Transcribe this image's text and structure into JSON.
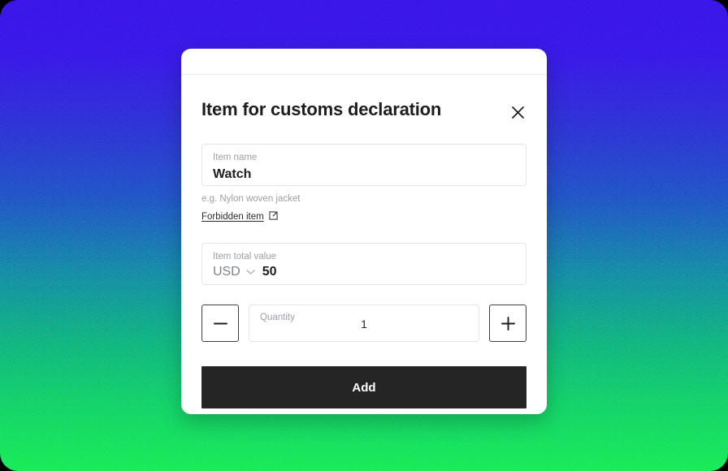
{
  "background": {
    "gradient_top": "#3b16ea",
    "gradient_mid": "#1f60c4",
    "gradient_bottom": "#1aec58"
  },
  "modal": {
    "title": "Item for customs declaration",
    "close_label": "×",
    "close_icon": "close-icon",
    "name_field": {
      "label": "Item name",
      "value": "Watch",
      "placeholder": "Item name"
    },
    "helper_text": "e.g. Nylon woven jacket",
    "forbidden_link": {
      "label": "Forbidden item",
      "icon": "external-link-icon"
    },
    "value_field": {
      "label": "Item total value",
      "currency": "USD",
      "currency_chevron_icon": "chevron-down-icon",
      "amount": "50"
    },
    "quantity": {
      "label": "Quantity",
      "value": "1",
      "decrement_icon": "minus-icon",
      "increment_icon": "plus-icon"
    },
    "submit": {
      "label": "Add",
      "background": "#252525",
      "text_color": "#ffffff"
    }
  }
}
